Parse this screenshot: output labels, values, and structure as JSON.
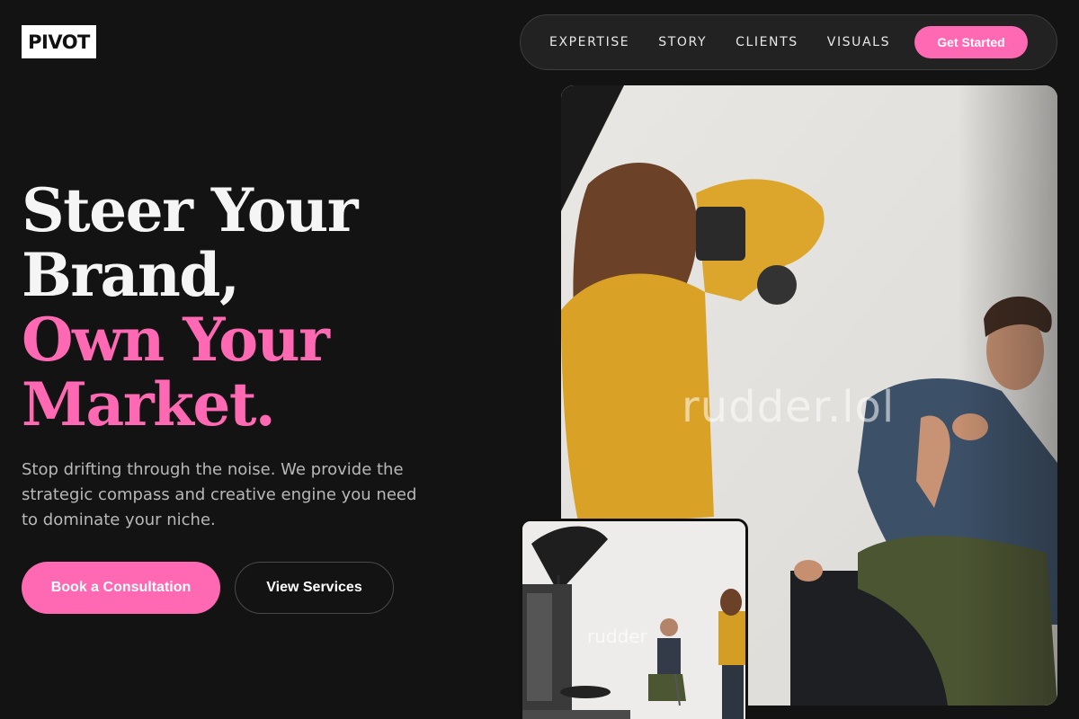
{
  "brand": {
    "logo_text": "PIVOT"
  },
  "nav": {
    "links": [
      "EXPERTISE",
      "STORY",
      "CLIENTS",
      "VISUALS"
    ],
    "cta_label": "Get Started"
  },
  "hero": {
    "headline_lines": [
      "Steer Your",
      "Brand,",
      "Own Your",
      "Market."
    ],
    "subtext": "Stop drifting through the noise. We provide the strategic compass and creative engine you need to dominate your niche.",
    "primary_button": "Book a Consultation",
    "secondary_button": "View Services"
  },
  "images": {
    "main_watermark": "rudder.lol",
    "thumb_watermark": "rudder"
  },
  "colors": {
    "background": "#131313",
    "accent": "#ff69b4",
    "nav_bg": "#222222"
  }
}
